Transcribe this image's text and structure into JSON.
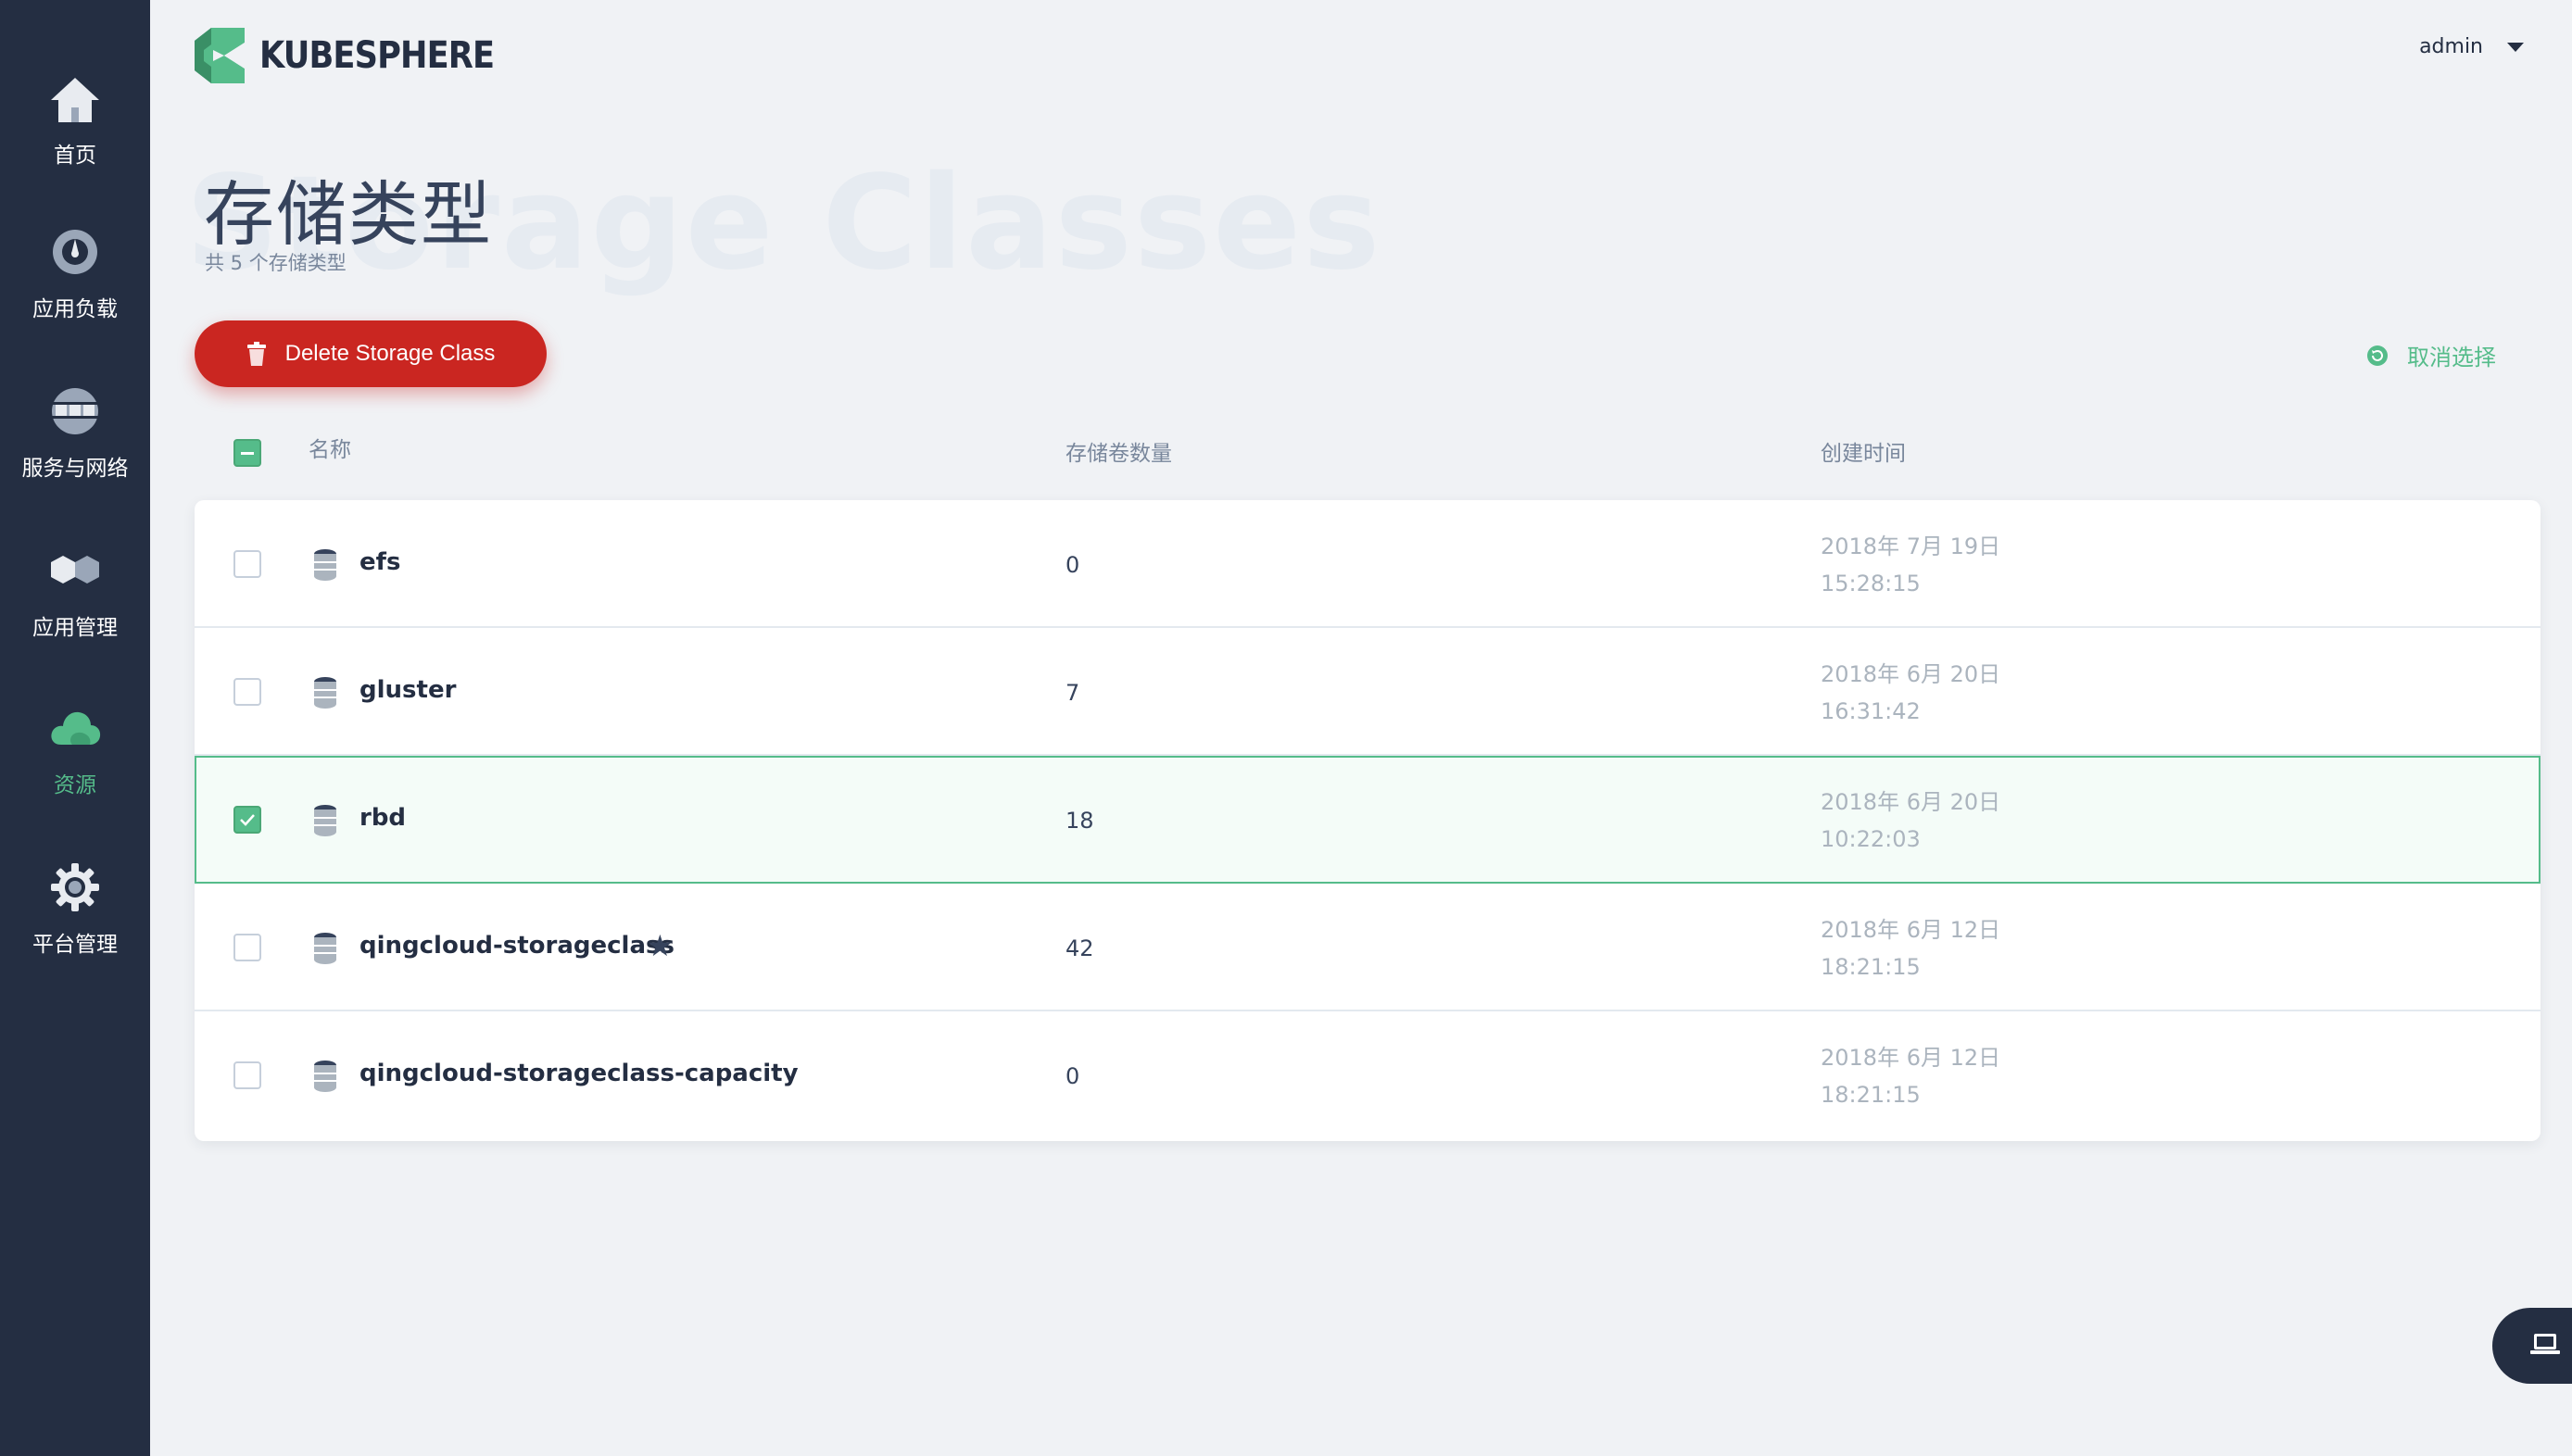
{
  "app": {
    "logo_text": "KUBESPHERE",
    "user": "admin"
  },
  "sidebar": {
    "items": [
      {
        "label": "首页",
        "icon": "home-icon"
      },
      {
        "label": "应用负载",
        "icon": "dashboard-icon"
      },
      {
        "label": "服务与网络",
        "icon": "network-icon"
      },
      {
        "label": "应用管理",
        "icon": "appstore-icon"
      },
      {
        "label": "资源",
        "icon": "cloud-icon",
        "active": true
      },
      {
        "label": "平台管理",
        "icon": "gear-icon"
      }
    ]
  },
  "page": {
    "bg_title": "Storage Classes",
    "title": "存储类型",
    "subtitle": "共 5 个存储类型"
  },
  "toolbar": {
    "delete_label": "Delete Storage Class",
    "deselect_label": "取消选择"
  },
  "table": {
    "columns": [
      "名称",
      "存储卷数量",
      "创建时间"
    ],
    "rows": [
      {
        "name": "efs",
        "count": "0",
        "date": "2018年 7月 19日",
        "time": "15:28:15",
        "selected": false,
        "default": false
      },
      {
        "name": "gluster",
        "count": "7",
        "date": "2018年 6月 20日",
        "time": "16:31:42",
        "selected": false,
        "default": false
      },
      {
        "name": "rbd",
        "count": "18",
        "date": "2018年 6月 20日",
        "time": "10:22:03",
        "selected": true,
        "default": false
      },
      {
        "name": "qingcloud-storageclass",
        "count": "42",
        "date": "2018年 6月 12日",
        "time": "18:21:15",
        "selected": false,
        "default": true
      },
      {
        "name": "qingcloud-storageclass-capacity",
        "count": "0",
        "date": "2018年 6月 12日",
        "time": "18:21:15",
        "selected": false,
        "default": false
      }
    ]
  },
  "colors": {
    "sidebar": "#242e42",
    "accent": "#55bc8a",
    "danger": "#ca2621",
    "background": "#f0f2f5"
  }
}
